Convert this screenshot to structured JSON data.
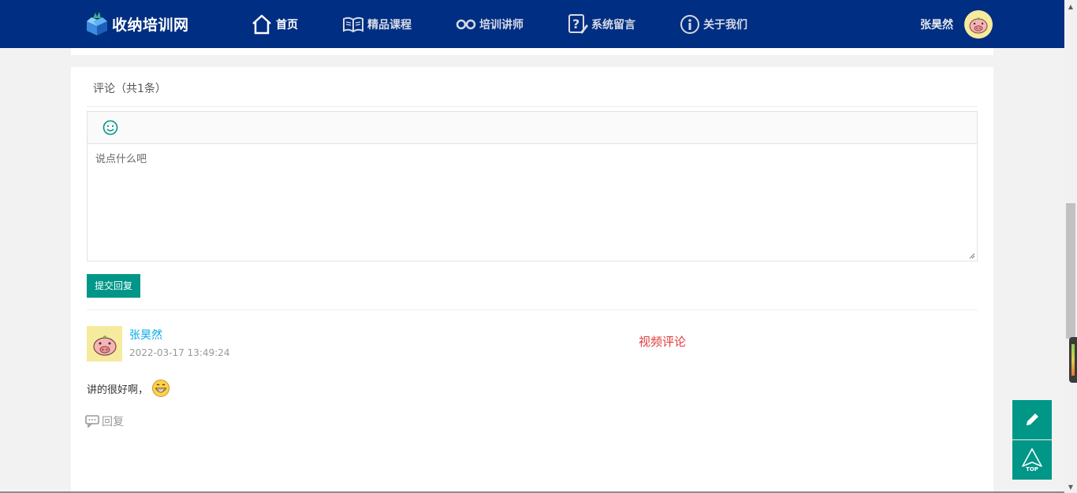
{
  "header": {
    "logo_text": "收纳培训网",
    "nav": [
      {
        "label": "首页",
        "icon": "home-icon"
      },
      {
        "label": "精品课程",
        "icon": "book-icon"
      },
      {
        "label": "培训讲师",
        "icon": "glasses-icon"
      },
      {
        "label": "系统留言",
        "icon": "question-note-icon"
      },
      {
        "label": "关于我们",
        "icon": "info-icon"
      }
    ],
    "user_name": "张昊然",
    "avatar_icon": "pig-avatar-icon"
  },
  "comments": {
    "title": "评论（共1条）",
    "editor": {
      "emoji_icon": "smiley-icon",
      "placeholder": "说点什么吧"
    },
    "submit_label": "提交回复",
    "items": [
      {
        "user": "张昊然",
        "time": "2022-03-17 13:49:24",
        "tag": "视频评论",
        "text": "讲的很好啊，",
        "emoji": "grinning-face-icon",
        "reply_label": "回复"
      }
    ]
  },
  "floating": {
    "edit_icon": "pencil-icon",
    "top_label": "TOP"
  },
  "colors": {
    "header_bg": "#002e82",
    "accent": "#009688",
    "link": "#01aaed",
    "tag": "#e23b3b"
  }
}
